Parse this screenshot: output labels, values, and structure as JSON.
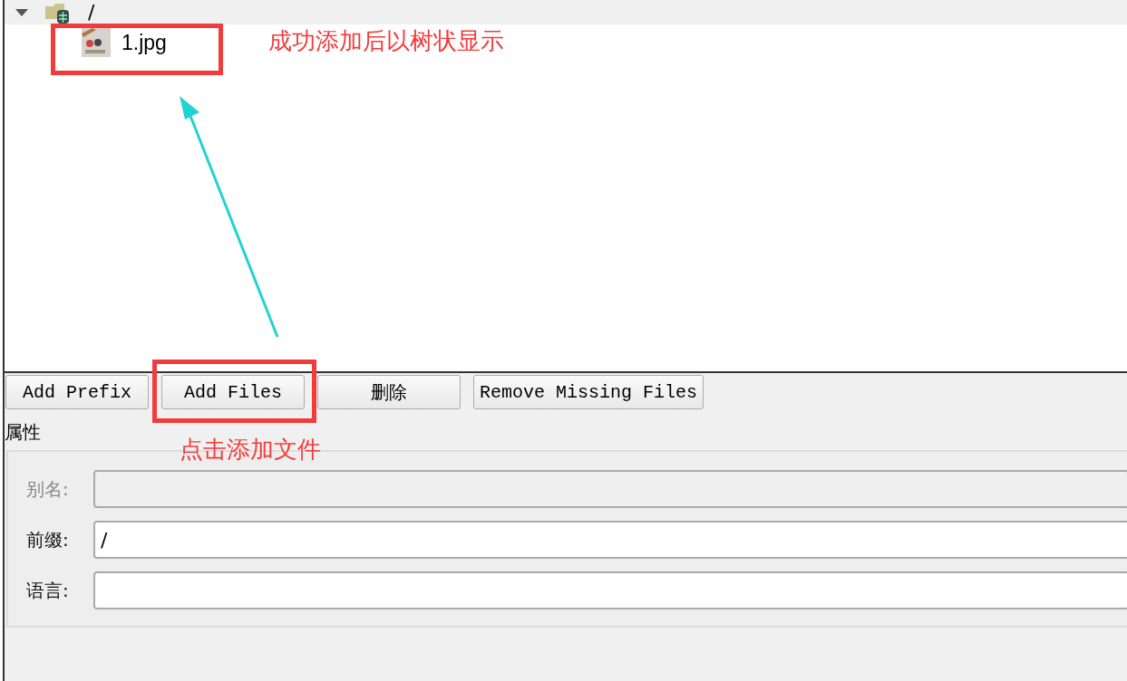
{
  "tree": {
    "items": [
      {
        "label": "/",
        "kind": "prefix",
        "expanded": true,
        "selected": true,
        "children": [
          {
            "label": "1.jpg",
            "kind": "image",
            "selected": false
          }
        ]
      }
    ]
  },
  "buttons": [
    "Add Prefix",
    "Add Files",
    "删除",
    "Remove Missing Files"
  ],
  "properties": {
    "title": "属性",
    "fields": [
      {
        "label": "别名:",
        "disabled": true
      },
      {
        "label": "前缀:",
        "value": "/",
        "disabled": false
      },
      {
        "label": "语言:",
        "disabled": false
      }
    ]
  },
  "annotations": [
    {
      "text": "成功添加后以树状显示"
    },
    {
      "text": "点击添加文件"
    }
  ]
}
